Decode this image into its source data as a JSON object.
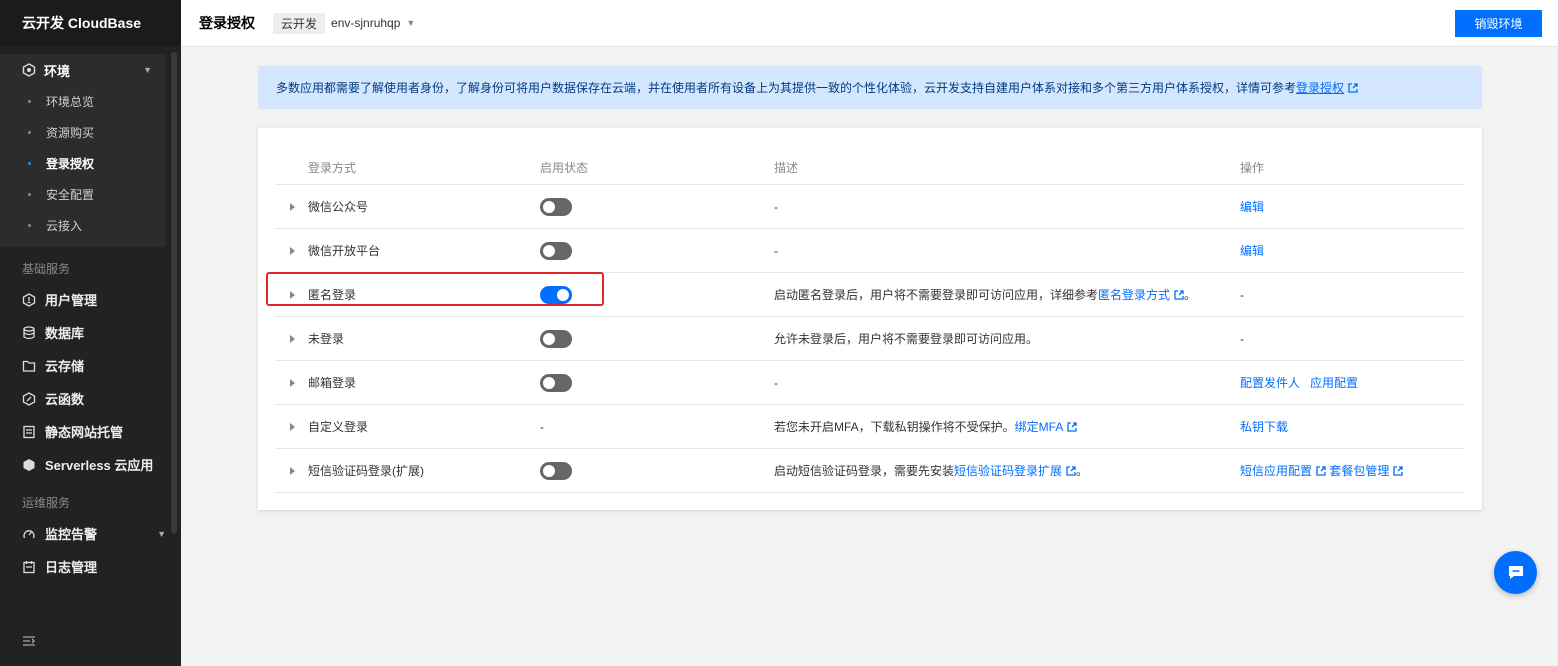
{
  "brand": "云开发 CloudBase",
  "sidebar": {
    "env_group": {
      "label": "环境",
      "items": [
        {
          "label": "环境总览"
        },
        {
          "label": "资源购买"
        },
        {
          "label": "登录授权",
          "active": true
        },
        {
          "label": "安全配置"
        },
        {
          "label": "云接入"
        }
      ]
    },
    "basic_section": "基础服务",
    "basic_items": [
      {
        "label": "用户管理",
        "icon": "user-manage-icon"
      },
      {
        "label": "数据库",
        "icon": "database-icon"
      },
      {
        "label": "云存储",
        "icon": "folder-icon"
      },
      {
        "label": "云函数",
        "icon": "function-icon"
      },
      {
        "label": "静态网站托管",
        "icon": "website-icon"
      },
      {
        "label": "Serverless 云应用",
        "icon": "serverless-icon"
      }
    ],
    "ops_section": "运维服务",
    "ops_items": [
      {
        "label": "监控告警",
        "icon": "monitor-icon"
      },
      {
        "label": "日志管理",
        "icon": "log-icon"
      }
    ]
  },
  "topbar": {
    "title": "登录授权",
    "env_tag": "云开发",
    "env_id": "env-sjnruhqp",
    "destroy_label": "销毁环境"
  },
  "notice": {
    "text": "多数应用都需要了解使用者身份，了解身份可将用户数据保存在云端，并在使用者所有设备上为其提供一致的个性化体验，云开发支持自建用户体系对接和多个第三方用户体系授权，详情可参考",
    "link": "登录授权"
  },
  "table": {
    "headers": [
      "登录方式",
      "启用状态",
      "描述",
      "操作"
    ],
    "rows": [
      {
        "name": "微信公众号",
        "enabled": false,
        "desc": "-",
        "actions": [
          "编辑"
        ]
      },
      {
        "name": "微信开放平台",
        "enabled": false,
        "desc": "-",
        "actions": [
          "编辑"
        ]
      },
      {
        "name": "匿名登录",
        "enabled": true,
        "desc_pre": "启动匿名登录后，用户将不需要登录即可访问应用，详细参考",
        "desc_link": "匿名登录方式",
        "desc_post": "。",
        "actions_text": "-"
      },
      {
        "name": "未登录",
        "enabled": false,
        "desc": "允许未登录后，用户将不需要登录即可访问应用。",
        "actions_text": "-"
      },
      {
        "name": "邮箱登录",
        "enabled": false,
        "desc": "-",
        "actions": [
          "配置发件人",
          "应用配置"
        ]
      },
      {
        "name": "自定义登录",
        "status_text": "-",
        "desc_pre": "若您未开启MFA，下载私钥操作将不受保护。",
        "desc_link": "绑定MFA",
        "desc_post": "",
        "actions": [
          "私钥下载"
        ]
      },
      {
        "name": "短信验证码登录(扩展)",
        "enabled": false,
        "desc_pre": "启动短信验证码登录，需要先安装",
        "desc_link": "短信验证码登录扩展",
        "desc_post": "。",
        "actions": [
          "短信应用配置",
          "套餐包管理"
        ]
      }
    ]
  },
  "colors": {
    "primary": "#006eff",
    "sidebar_bg": "#222222",
    "highlight": "#e0262b"
  }
}
